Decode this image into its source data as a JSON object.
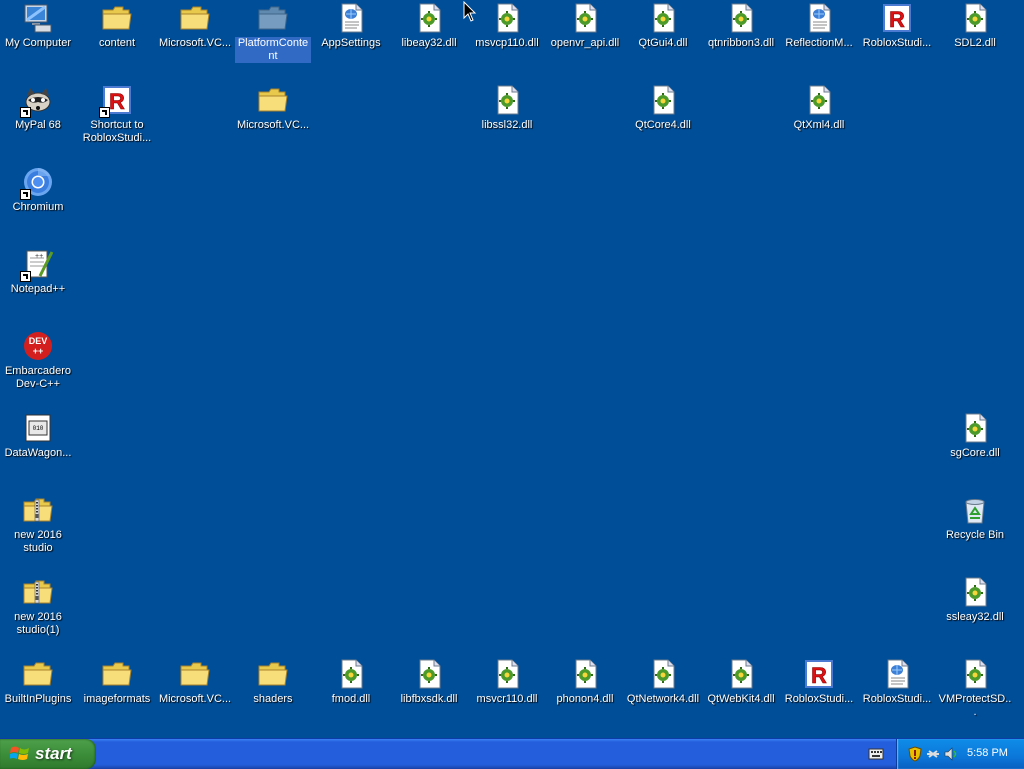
{
  "desktop": {
    "icons": [
      {
        "label": "My Computer",
        "type": "computer"
      },
      {
        "label": "content",
        "type": "folder"
      },
      {
        "label": "Microsoft.VC...",
        "type": "folder"
      },
      {
        "label": "PlatformContent",
        "type": "folder-gray",
        "selected": true
      },
      {
        "label": "AppSettings",
        "type": "xml"
      },
      {
        "label": "libeay32.dll",
        "type": "dll"
      },
      {
        "label": "msvcp110.dll",
        "type": "dll"
      },
      {
        "label": "openvr_api.dll",
        "type": "dll"
      },
      {
        "label": "QtGui4.dll",
        "type": "dll"
      },
      {
        "label": "qtnribbon3.dll",
        "type": "dll"
      },
      {
        "label": "ReflectionM...",
        "type": "xml"
      },
      {
        "label": "RobloxStudi...",
        "type": "roblox"
      },
      {
        "label": "SDL2.dll",
        "type": "dll"
      },
      {
        "label": "MyPal 68",
        "type": "raccoon",
        "shortcut": true
      },
      {
        "label": "Shortcut to RobloxStudi...",
        "type": "roblox",
        "shortcut": true
      },
      {
        "label": "Microsoft.VC...",
        "type": "folder"
      },
      {
        "label": "libssl32.dll",
        "type": "dll"
      },
      {
        "label": "QtCore4.dll",
        "type": "dll"
      },
      {
        "label": "QtXml4.dll",
        "type": "dll"
      },
      {
        "label": "Chromium",
        "type": "chromium",
        "shortcut": true
      },
      {
        "label": "Notepad++",
        "type": "notepad",
        "shortcut": true
      },
      {
        "label": "Embarcadero Dev-C++",
        "type": "devcpp"
      },
      {
        "label": "DataWagon...",
        "type": "datawagon"
      },
      {
        "label": "sgCore.dll",
        "type": "dll"
      },
      {
        "label": "new 2016 studio",
        "type": "zip"
      },
      {
        "label": "Recycle Bin",
        "type": "recycle"
      },
      {
        "label": "new 2016 studio(1)",
        "type": "zip"
      },
      {
        "label": "ssleay32.dll",
        "type": "dll"
      },
      {
        "label": "BuiltInPlugins",
        "type": "folder"
      },
      {
        "label": "imageformats",
        "type": "folder"
      },
      {
        "label": "Microsoft.VC...",
        "type": "folder"
      },
      {
        "label": "shaders",
        "type": "folder"
      },
      {
        "label": "fmod.dll",
        "type": "dll"
      },
      {
        "label": "libfbxsdk.dll",
        "type": "dll"
      },
      {
        "label": "msvcr110.dll",
        "type": "dll"
      },
      {
        "label": "phonon4.dll",
        "type": "dll"
      },
      {
        "label": "QtNetwork4.dll",
        "type": "dll"
      },
      {
        "label": "QtWebKit4.dll",
        "type": "dll"
      },
      {
        "label": "RobloxStudi...",
        "type": "roblox"
      },
      {
        "label": "RobloxStudi...",
        "type": "xml"
      },
      {
        "label": "VMProtectSD...",
        "type": "dll"
      }
    ]
  },
  "taskbar": {
    "start_label": "start",
    "clock": "5:58 PM",
    "tray_icons": [
      "security-shield-icon",
      "network-icon",
      "volume-icon"
    ]
  },
  "colors": {
    "desktop_bg": "#004e98",
    "taskbar_blue": "#245edc",
    "start_green": "#3c8e3a",
    "selection": "#316ac5"
  }
}
